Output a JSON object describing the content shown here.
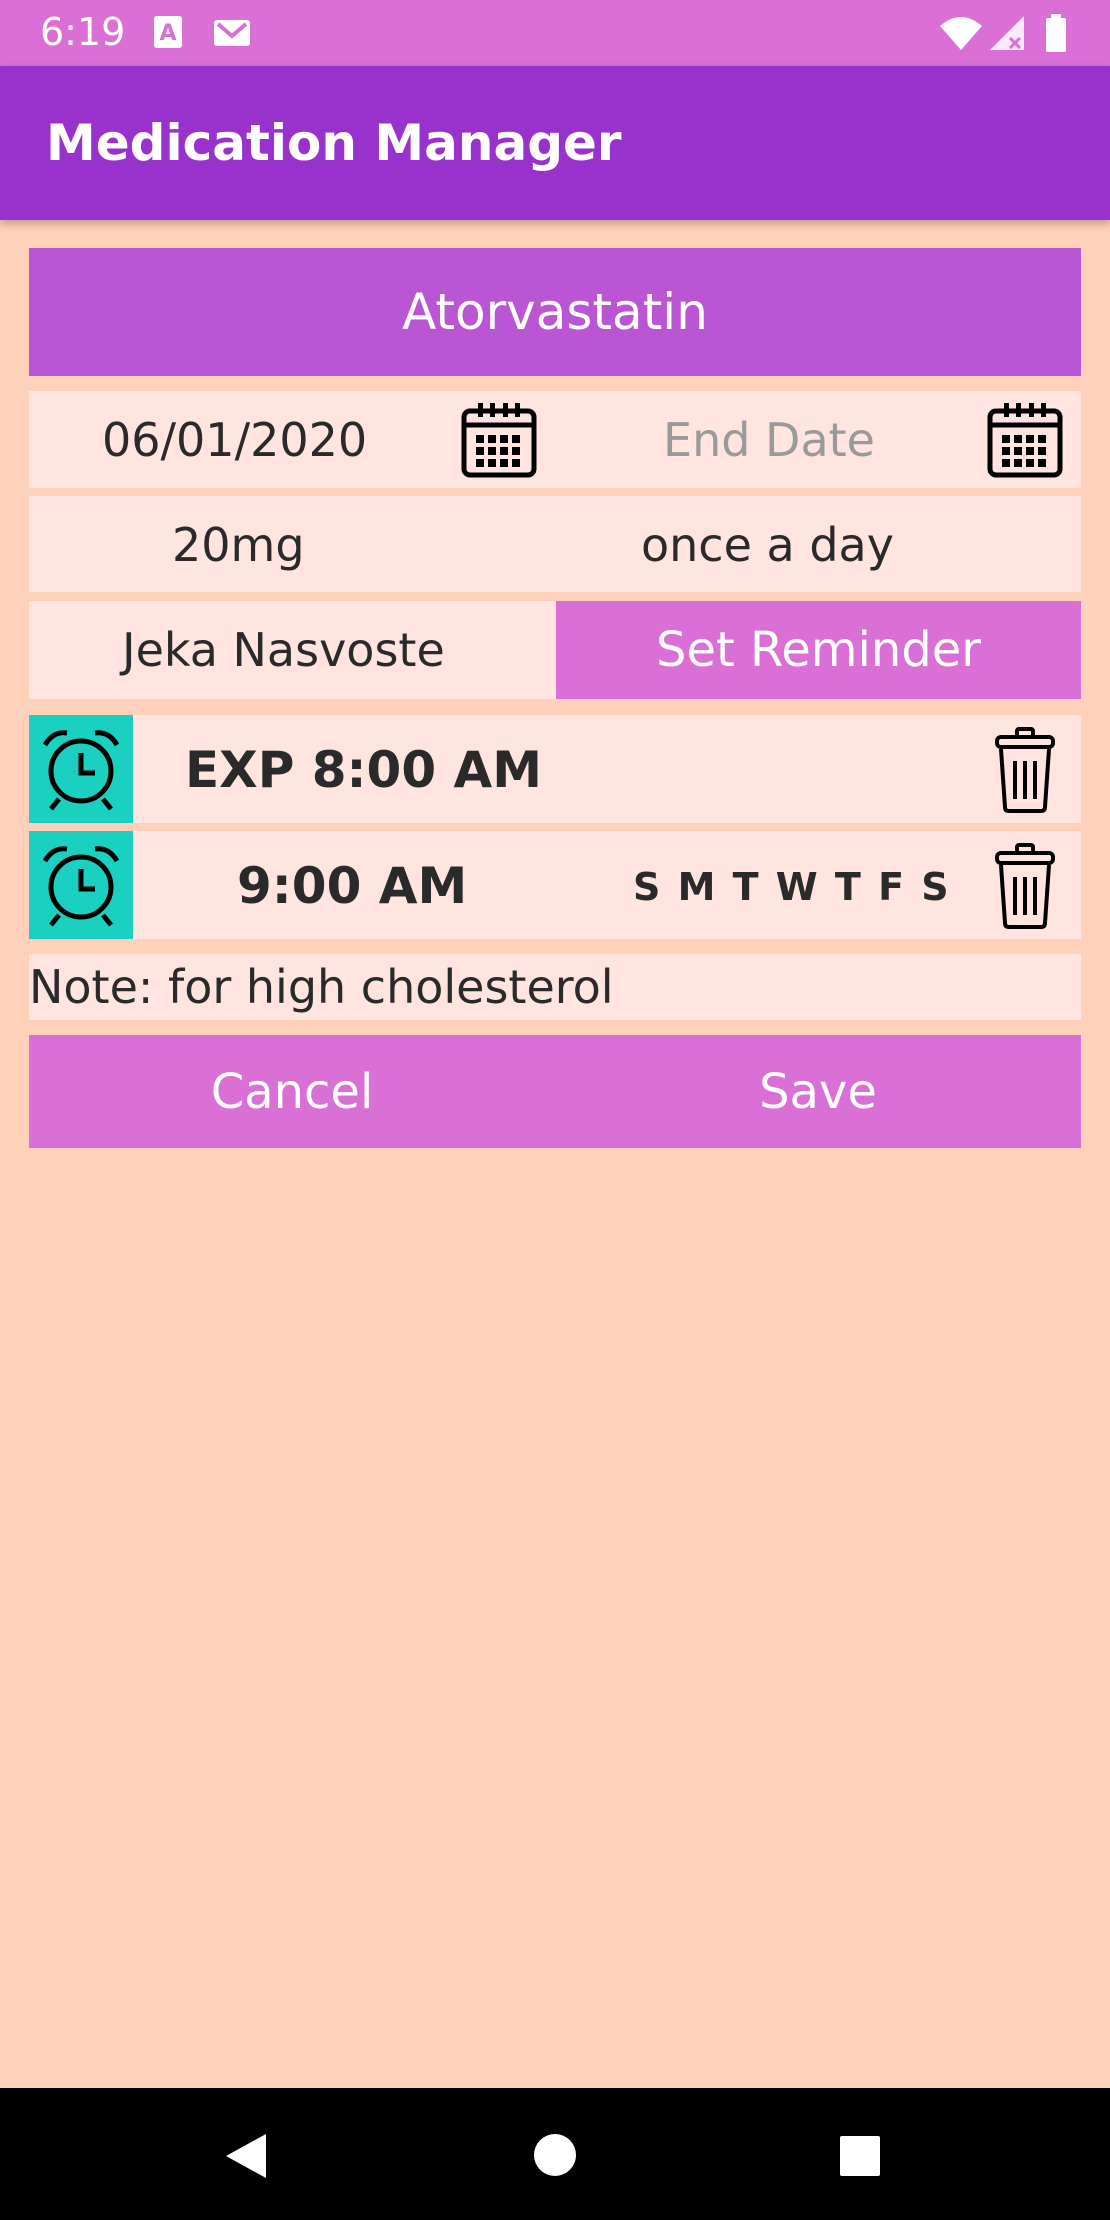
{
  "status_bar": {
    "time": "6:19"
  },
  "app_bar": {
    "title": "Medication Manager"
  },
  "medication": {
    "name": "Atorvastatin",
    "start_date": "06/01/2020",
    "end_date_placeholder": "End Date",
    "dosage": "20mg",
    "frequency": "once a day",
    "patient": "Jeka Nasvoste",
    "set_reminder_label": "Set Reminder"
  },
  "reminders": [
    {
      "time": "EXP 8:00 AM",
      "days": ""
    },
    {
      "time": "9:00 AM",
      "days": "S M T W T F S"
    }
  ],
  "note": "Note: for high cholesterol",
  "actions": {
    "cancel": "Cancel",
    "save": "Save"
  },
  "colors": {
    "status_bar": "#da70d6",
    "app_bar": "#9932cc",
    "med_name_bg": "#ba55d3",
    "accent": "#da70d6",
    "alarm_tile": "#1ad1c1",
    "background": "#ffd1ba",
    "card": "#ffe4e0"
  }
}
